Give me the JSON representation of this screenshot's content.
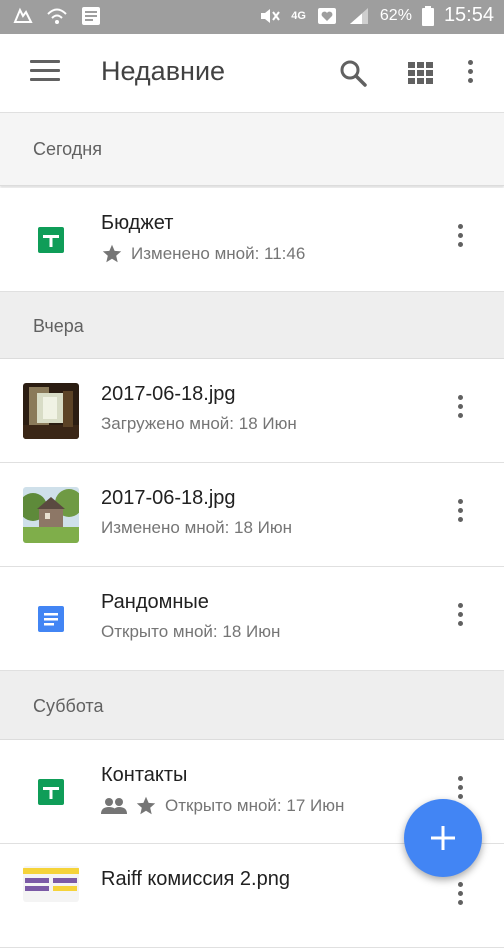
{
  "status_bar": {
    "battery_percent": "62%",
    "time": "15:54",
    "network": "4G"
  },
  "app_bar": {
    "title": "Недавние",
    "icons": [
      "menu-icon",
      "search-icon",
      "grid-view-icon",
      "more-vert-icon"
    ]
  },
  "sections": [
    {
      "label": "Сегодня",
      "files": [
        {
          "name": "Бюджет",
          "meta": "Изменено мной: 11:46",
          "type": "sheets",
          "starred": true,
          "shared": false
        }
      ]
    },
    {
      "label": "Вчера",
      "files": [
        {
          "name": "2017-06-18.jpg",
          "meta": "Загружено мной: 18 Июн",
          "type": "image-room"
        },
        {
          "name": "2017-06-18.jpg",
          "meta": "Изменено мной: 18 Июн",
          "type": "image-house"
        },
        {
          "name": "Рандомные",
          "meta": "Открыто мной: 18 Июн",
          "type": "docs"
        }
      ]
    },
    {
      "label": "Суббота",
      "files": [
        {
          "name": "Контакты",
          "meta": "Открыто мной: 17 Июн",
          "type": "sheets",
          "starred": true,
          "shared": true
        },
        {
          "name": "Raiff комиссия 2.png",
          "meta": "",
          "type": "image-screenshot"
        }
      ]
    }
  ],
  "fab": {
    "icon": "plus-icon"
  },
  "colors": {
    "status_bar": "#9e9e9e",
    "sheets_green": "#0f9d58",
    "docs_blue": "#4285f4",
    "fab_blue": "#4285f4",
    "section_bg": "#eeeeee"
  }
}
